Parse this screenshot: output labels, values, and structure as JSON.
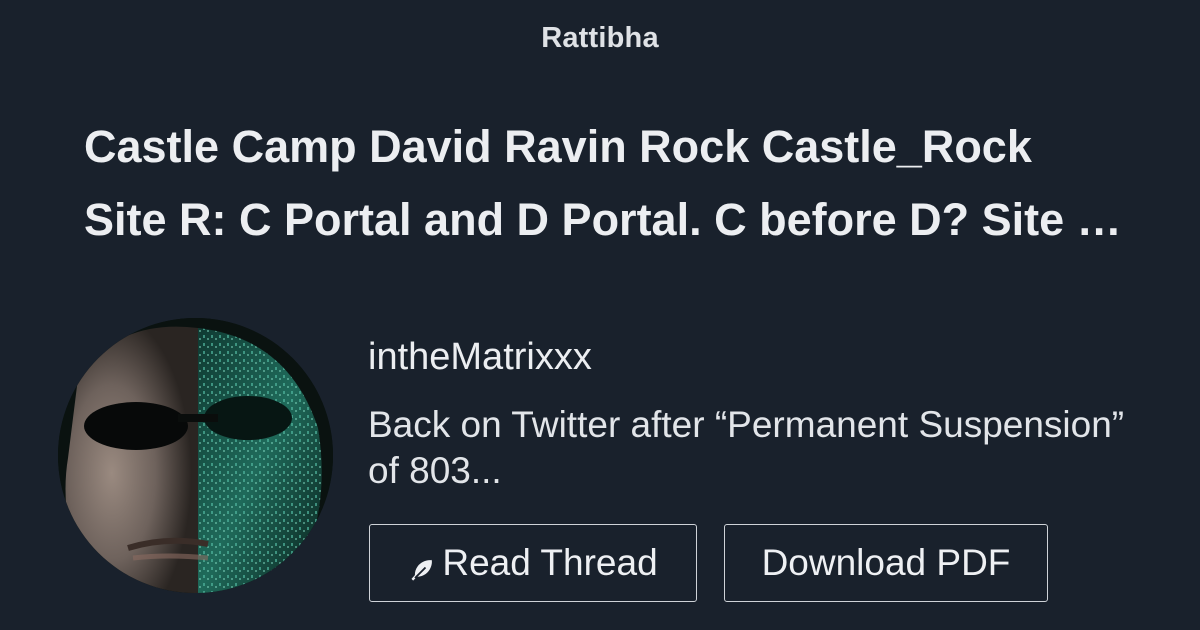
{
  "brand": "Rattibha",
  "thread": {
    "title_line1": "Castle Camp David Ravin Rock Castle_Rock",
    "title_line2": "Site R: C Portal and D Portal. C before D? Site R Portal C and D"
  },
  "author": {
    "username": "intheMatrixxx",
    "bio_line1": "Back on Twitter after “Permanent Suspension”",
    "bio_line2": "of 803...",
    "avatar_icon": "avatar-photo"
  },
  "actions": {
    "read_label": "Read Thread",
    "read_icon": "feather-icon",
    "pdf_label": "Download PDF"
  },
  "colors": {
    "background": "#19212c",
    "text": "#eceef1",
    "border": "#cfd3d8"
  }
}
